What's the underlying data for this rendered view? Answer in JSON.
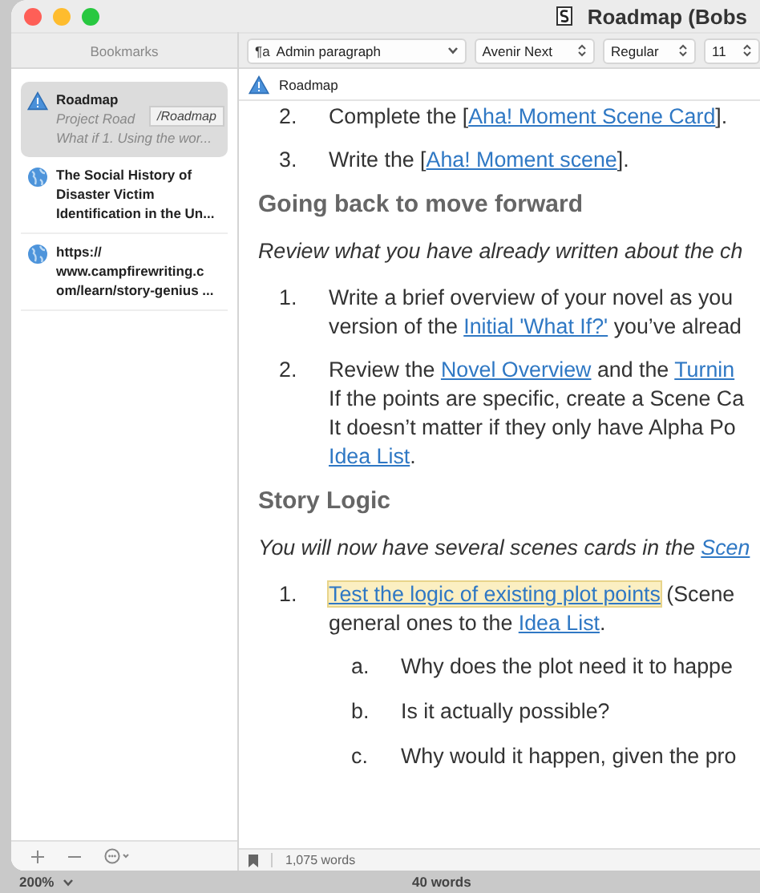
{
  "window": {
    "title": "Roadmap (Bobs"
  },
  "toolbar": {
    "paragraph_style": {
      "glyph": "¶a",
      "value": "Admin paragraph"
    },
    "font": "Avenir Next",
    "weight": "Regular",
    "size": "11"
  },
  "sidebar": {
    "title": "Bookmarks",
    "items": [
      {
        "kind": "document",
        "selected": true,
        "title": "Roadmap",
        "subtitle_lines": [
          "Project Road",
          "What if 1. Using the wor..."
        ],
        "tooltip": "/Roadmap"
      },
      {
        "kind": "web",
        "selected": false,
        "title_lines": [
          "The Social History of",
          "Disaster Victim",
          "Identification in the Un..."
        ]
      },
      {
        "kind": "web",
        "selected": false,
        "title_lines": [
          "https://",
          "www.campfirewriting.c",
          "om/learn/story-genius ..."
        ]
      }
    ]
  },
  "editor": {
    "header": "Roadmap",
    "blocks": [
      {
        "kind": "item",
        "marker": "2.",
        "lines": [
          [
            {
              "kind": "text",
              "t": "Complete the ["
            },
            {
              "kind": "link",
              "t": "Aha! Moment Scene Card"
            },
            {
              "kind": "text",
              "t": "]."
            }
          ]
        ]
      },
      {
        "kind": "item",
        "marker": "3.",
        "lines": [
          [
            {
              "kind": "text",
              "t": "Write the ["
            },
            {
              "kind": "link",
              "t": "Aha! Moment scene"
            },
            {
              "kind": "text",
              "t": "]."
            }
          ]
        ]
      },
      {
        "kind": "heading",
        "text": "Going back to move forward"
      },
      {
        "kind": "note",
        "lines": [
          [
            {
              "kind": "text",
              "t": "Review what you have already written about the ch"
            }
          ]
        ]
      },
      {
        "kind": "item",
        "marker": "1.",
        "lines": [
          [
            {
              "kind": "text",
              "t": "Write a brief overview of your novel as you"
            }
          ],
          [
            {
              "kind": "text",
              "t": "version of the "
            },
            {
              "kind": "link",
              "t": "Initial 'What If?'"
            },
            {
              "kind": "text",
              "t": " you’ve alread"
            }
          ]
        ]
      },
      {
        "kind": "item",
        "marker": "2.",
        "lines": [
          [
            {
              "kind": "text",
              "t": "Review the "
            },
            {
              "kind": "link",
              "t": "Novel Overview"
            },
            {
              "kind": "text",
              "t": " and the "
            },
            {
              "kind": "link",
              "t": "Turnin"
            }
          ],
          [
            {
              "kind": "text",
              "t": "If the points are specific, create a Scene Ca"
            }
          ],
          [
            {
              "kind": "text",
              "t": "It doesn’t matter if they only have Alpha Po"
            }
          ],
          [
            {
              "kind": "link",
              "t": "Idea List"
            },
            {
              "kind": "text",
              "t": "."
            }
          ]
        ]
      },
      {
        "kind": "heading",
        "text": "Story Logic"
      },
      {
        "kind": "note",
        "lines": [
          [
            {
              "kind": "text",
              "t": "You will now have several scenes cards in the "
            },
            {
              "kind": "link",
              "t": "Scen"
            }
          ]
        ]
      },
      {
        "kind": "item",
        "marker": "1.",
        "lines": [
          [
            {
              "kind": "highlight",
              "t": "Test the logic of existing plot points"
            },
            {
              "kind": "text",
              "t": " (Scene"
            }
          ],
          [
            {
              "kind": "text",
              "t": "general ones to the "
            },
            {
              "kind": "link",
              "t": "Idea List"
            },
            {
              "kind": "text",
              "t": "."
            }
          ]
        ]
      },
      {
        "kind": "subitem",
        "marker": "a.",
        "lines": [
          [
            {
              "kind": "text",
              "t": "Why does the plot need it to happe"
            }
          ]
        ]
      },
      {
        "kind": "subitem",
        "marker": "b.",
        "lines": [
          [
            {
              "kind": "text",
              "t": "Is it actually possible?"
            }
          ]
        ]
      },
      {
        "kind": "subitem",
        "marker": "c.",
        "lines": [
          [
            {
              "kind": "text",
              "t": "Why would it happen, given the pro"
            }
          ]
        ]
      }
    ],
    "word_count": "1,075 words"
  },
  "behind": {
    "zoom": "200%",
    "word_count": "40 words"
  }
}
